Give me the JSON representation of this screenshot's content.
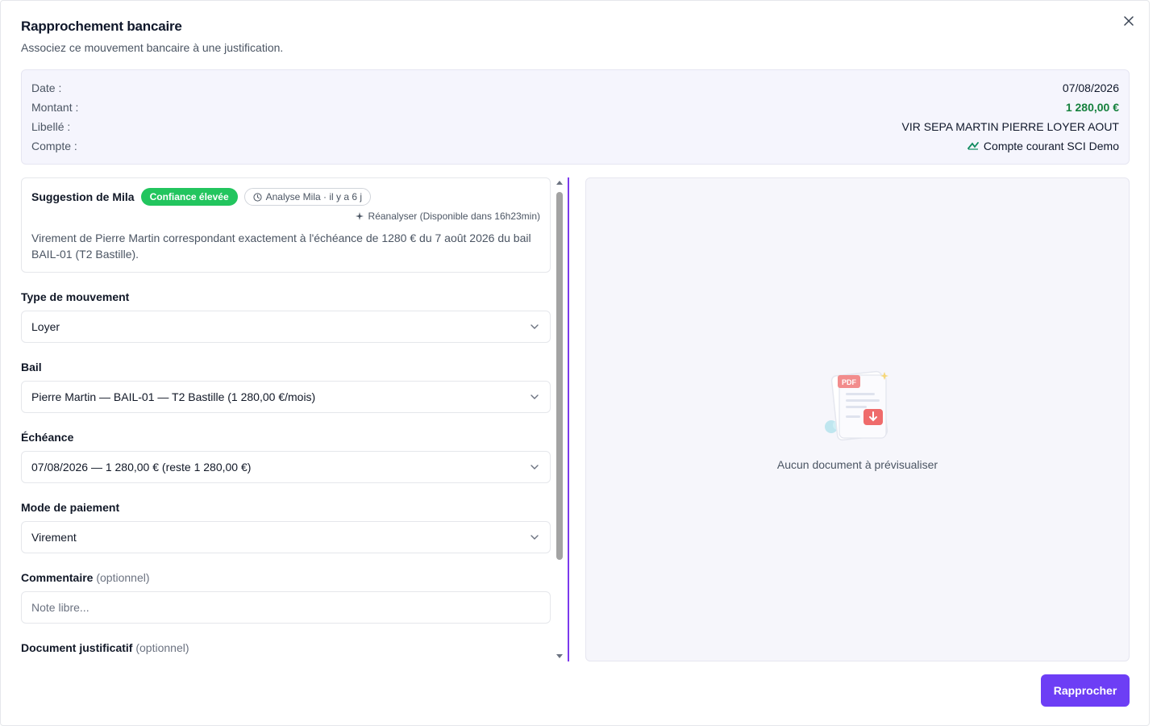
{
  "dialog": {
    "title": "Rapprochement bancaire",
    "subtitle": "Associez ce mouvement bancaire à une justification."
  },
  "transaction": {
    "date_label": "Date :",
    "date_value": "07/08/2026",
    "amount_label": "Montant :",
    "amount_value": "1 280,00 €",
    "libelle_label": "Libellé :",
    "libelle_value": "VIR SEPA MARTIN PIERRE LOYER AOUT",
    "account_label": "Compte :",
    "account_value": "Compte courant SCI Demo",
    "account_icon": "bank-logo-icon"
  },
  "suggestion": {
    "title": "Suggestion de Mila",
    "confidence_badge": "Confiance élevée",
    "analysis_badge": "Analyse Mila · il y a 6 j",
    "reanalyse_label": "Réanalyser (Disponible dans 16h23min)",
    "text": "Virement de Pierre Martin correspondant exactement à l'échéance de 1280 € du 7 août 2026 du bail BAIL-01 (T2 Bastille)."
  },
  "form": {
    "type_label": "Type de mouvement",
    "type_value": "Loyer",
    "bail_label": "Bail",
    "bail_value": "Pierre Martin — BAIL-01 — T2 Bastille (1 280,00 €/mois)",
    "echeance_label": "Échéance",
    "echeance_value": "07/08/2026 — 1 280,00 € (reste 1 280,00 €)",
    "payment_label": "Mode de paiement",
    "payment_value": "Virement",
    "comment_label": "Commentaire",
    "comment_optional": "(optionnel)",
    "comment_placeholder": "Note libre...",
    "document_label": "Document justificatif",
    "document_optional": "(optionnel)"
  },
  "preview": {
    "illustration_badge": "PDF",
    "empty_text": "Aucun document à prévisualiser"
  },
  "actions": {
    "submit_label": "Rapprocher"
  },
  "colors": {
    "accent": "#6d3ef5",
    "amount_green": "#15803d",
    "badge_green": "#22c55e"
  }
}
